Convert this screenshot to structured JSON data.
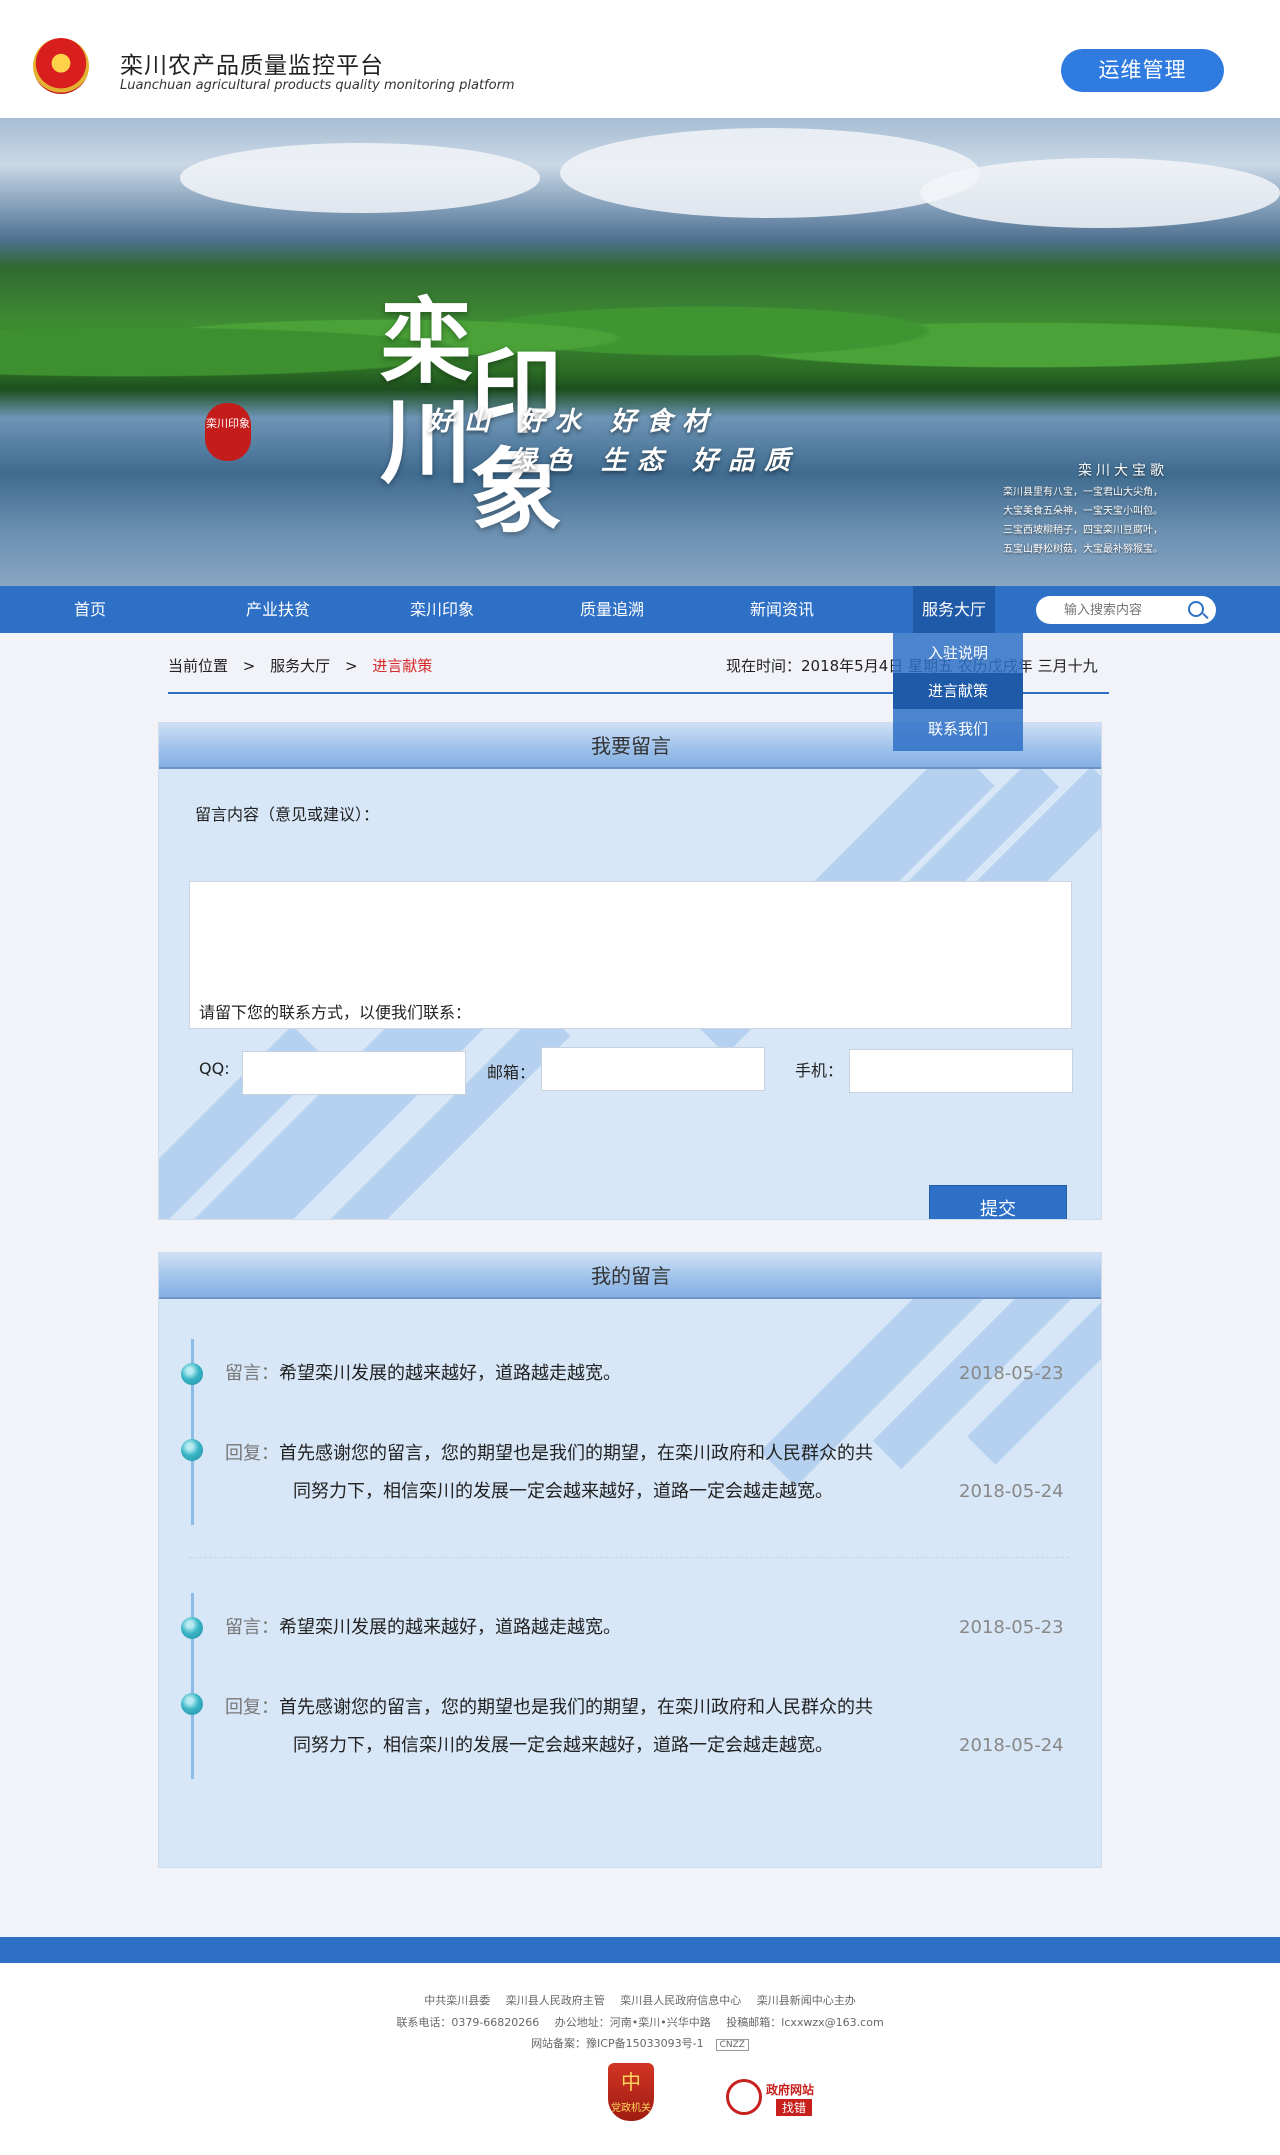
{
  "header": {
    "title": "栾川农产品质量监控平台",
    "subtitle": "Luanchuan agricultural products quality monitoring platform",
    "ops_button": "运维管理"
  },
  "banner": {
    "calligraphy": [
      "栾",
      "印",
      "川",
      "象"
    ],
    "seal_text": "栾川印象",
    "slogan_1": "好山 好水 好食材",
    "slogan_2": "绿色 生态 好品质",
    "poem_title": "栾川大宝歌",
    "poem_lines": [
      "栾川县里有八宝，一宝君山大尖角，",
      "大宝美食五朵神，一宝天宝小叫包。",
      "三宝西坡柳稍子，四宝栾川豆腐叶，",
      "五宝山野松树菇，大宝最补猕猴宝。"
    ]
  },
  "nav": {
    "items": [
      "首页",
      "产业扶贫",
      "栾川印象",
      "质量追溯",
      "新闻资讯",
      "服务大厅"
    ],
    "search_placeholder": "输入搜索内容"
  },
  "dropdown": {
    "items": [
      "入驻说明",
      "进言献策",
      "联系我们"
    ]
  },
  "breadcrumb": {
    "location": "当前位置",
    "sep": ">",
    "level1": "服务大厅",
    "current": "进言献策"
  },
  "time_now": "现在时间：2018年5月4日 星期五 农历戊戌年 三月十九",
  "form": {
    "title": "我要留言",
    "content_label": "留言内容（意见或建议）：",
    "contact_label": "请留下您的联系方式，以便我们联系：",
    "qq_label": "QQ:",
    "email_label": "邮箱：",
    "phone_label": "手机：",
    "submit": "提交"
  },
  "messages": {
    "title": "我的留言",
    "items": [
      {
        "msg_prefix": "留言：",
        "msg": "希望栾川发展的越来越好，道路越走越宽。",
        "msg_date": "2018-05-23",
        "reply_prefix": "回复：",
        "reply_line1": "首先感谢您的留言，您的期望也是我们的期望，在栾川政府和人民群众的共",
        "reply_line2": "同努力下，相信栾川的发展一定会越来越好，道路一定会越走越宽。",
        "reply_date": "2018-05-24"
      },
      {
        "msg_prefix": "留言：",
        "msg": "希望栾川发展的越来越好，道路越走越宽。",
        "msg_date": "2018-05-23",
        "reply_prefix": "回复：",
        "reply_line1": "首先感谢您的留言，您的期望也是我们的期望，在栾川政府和人民群众的共",
        "reply_line2": "同努力下，相信栾川的发展一定会越来越好，道路一定会越走越宽。",
        "reply_date": "2018-05-24"
      }
    ]
  },
  "footer": {
    "line1": [
      "中共栾川县委",
      "栾川县人民政府主管",
      "栾川县人民政府信息中心",
      "栾川县新闻中心主办"
    ],
    "line2": [
      "联系电话：0379-66820266",
      "办公地址：河南•栾川•兴华中路",
      "投稿邮箱：lcxxwzx@163.com"
    ],
    "line3": "网站备案：豫ICP备15033093号-1",
    "cnzz": "CNZZ",
    "badge_party": "党政机关",
    "gov_badge_1": "政府网站",
    "gov_badge_2": "找错"
  },
  "colors": {
    "accent": "#2f70c7",
    "nav_active": "#1f5aa8",
    "breadcrumb_current": "#d62b2b",
    "panel_bg": "#d8e7f7"
  }
}
